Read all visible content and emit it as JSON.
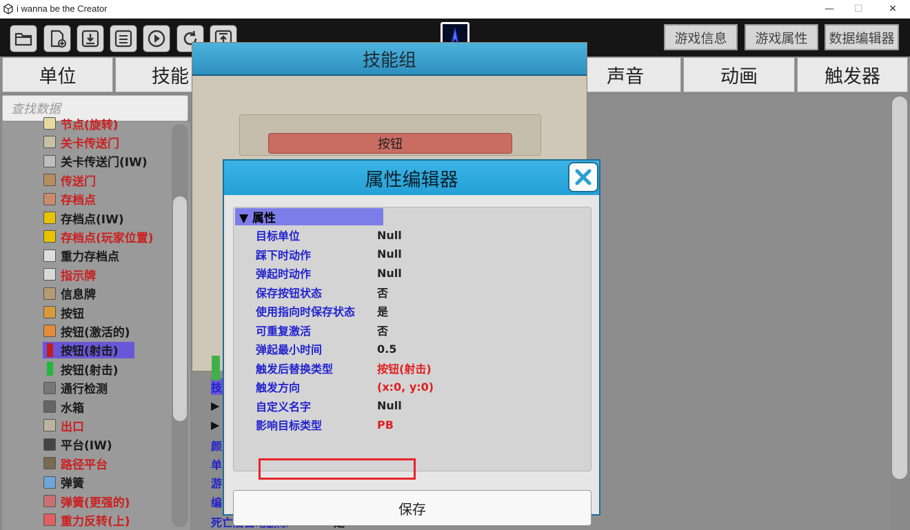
{
  "window": {
    "title": "i wanna be the Creator",
    "minimize": "—",
    "maximize": "☐",
    "close": "✕"
  },
  "toolbar": {
    "buttons": [
      "folder-icon",
      "new-file-icon",
      "download-icon",
      "save-disk-icon",
      "play-icon",
      "refresh-icon",
      "upload-icon"
    ],
    "game_info": "游戏信息",
    "game_props": "游戏属性",
    "data_editor": "数据编辑器"
  },
  "tabs": [
    "单位",
    "技能",
    "声音",
    "动画",
    "触发器"
  ],
  "search": {
    "placeholder": "查找数据"
  },
  "sidebar": {
    "items": [
      {
        "label": "节点(旋转)",
        "icon": "node-rotate-icon",
        "color": "#cc1f1f"
      },
      {
        "label": "关卡传送门",
        "icon": "level-portal-icon",
        "color": "#cc1f1f"
      },
      {
        "label": "关卡传送门(IW)",
        "icon": "level-portal-iw-icon",
        "color": "#1a1a1a"
      },
      {
        "label": "传送门",
        "icon": "portal-icon",
        "color": "#cc1f1f"
      },
      {
        "label": "存档点",
        "icon": "savepoint-icon",
        "color": "#cc1f1f"
      },
      {
        "label": "存档点(IW)",
        "icon": "savepoint-iw-icon",
        "color": "#1a1a1a"
      },
      {
        "label": "存档点(玩家位置)",
        "icon": "savepoint-player-icon",
        "color": "#cc1f1f"
      },
      {
        "label": "重力存档点",
        "icon": "gravity-savepoint-icon",
        "color": "#1a1a1a"
      },
      {
        "label": "指示牌",
        "icon": "sign-icon",
        "color": "#cc1f1f"
      },
      {
        "label": "信息牌",
        "icon": "info-sign-icon",
        "color": "#1a1a1a"
      },
      {
        "label": "按钮",
        "icon": "button-icon",
        "color": "#1a1a1a"
      },
      {
        "label": "按钮(激活的)",
        "icon": "button-active-icon",
        "color": "#1a1a1a"
      },
      {
        "label": "按钮(射击)",
        "icon": "button-shoot-red-icon",
        "color": "#1a1a1a"
      },
      {
        "label": "按钮(射击)",
        "icon": "button-shoot-green-icon",
        "color": "#1a1a1a"
      },
      {
        "label": "通行检测",
        "icon": "pass-check-icon",
        "color": "#1a1a1a"
      },
      {
        "label": "水箱",
        "icon": "water-tank-icon",
        "color": "#1a1a1a"
      },
      {
        "label": "出口",
        "icon": "exit-icon",
        "color": "#cc1f1f"
      },
      {
        "label": "平台(IW)",
        "icon": "platform-iw-icon",
        "color": "#1a1a1a"
      },
      {
        "label": "路径平台",
        "icon": "path-platform-icon",
        "color": "#cc1f1f"
      },
      {
        "label": "弹簧",
        "icon": "spring-icon",
        "color": "#1a1a1a"
      },
      {
        "label": "弹簧(更强的)",
        "icon": "spring-strong-icon",
        "color": "#cc1f1f"
      },
      {
        "label": "重力反转(上)",
        "icon": "gravity-flip-up-icon",
        "color": "#cc1f1f"
      }
    ]
  },
  "skill_dialog": {
    "title": "技能组",
    "button_label": "按钮"
  },
  "background_rows": [
    "技",
    "▶",
    "▶",
    "颜",
    "单",
    "游",
    "编",
    "死亡后自动删除"
  ],
  "background_value": "是",
  "property_editor": {
    "title": "属性编辑器",
    "section": "▼ 属性",
    "rows": [
      {
        "key": "目标单位",
        "value": "Null",
        "value_red": false
      },
      {
        "key": "踩下时动作",
        "value": "Null",
        "value_red": false
      },
      {
        "key": "弹起时动作",
        "value": "Null",
        "value_red": false
      },
      {
        "key": "保存按钮状态",
        "value": "否",
        "value_red": false
      },
      {
        "key": "使用指向时保存状态",
        "value": "是",
        "value_red": false
      },
      {
        "key": "可重复激活",
        "value": "否",
        "value_red": false
      },
      {
        "key": "弹起最小时间",
        "value": "0.5",
        "value_red": false
      },
      {
        "key": "触发后替换类型",
        "value": "按钮(射击)",
        "value_red": true
      },
      {
        "key": "触发方向",
        "value": "(x:0, y:0)",
        "value_red": true
      },
      {
        "key": "自定义名字",
        "value": "Null",
        "value_red": false
      },
      {
        "key": "影响目标类型",
        "value": "PB",
        "value_red": true
      }
    ],
    "save_label": "保存"
  }
}
